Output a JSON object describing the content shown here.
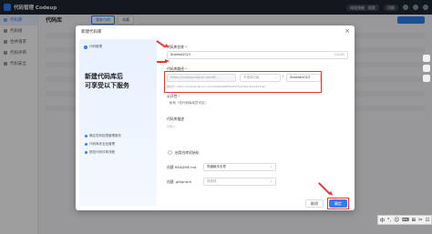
{
  "app": {
    "brand": "代码管理 Codeup"
  },
  "topbar": {
    "search_pill": "研发效能 · 搜索",
    "user_pill": "切换"
  },
  "sidenav": {
    "items": [
      {
        "label": "代码库",
        "active": true
      },
      {
        "label": "代码组",
        "active": false
      },
      {
        "label": "合并请求",
        "active": false
      },
      {
        "label": "代码评审",
        "active": false
      },
      {
        "label": "代码安全",
        "active": false
      }
    ]
  },
  "page": {
    "title": "代码库",
    "tabs": [
      {
        "label": "我参与的",
        "active": true
      },
      {
        "label": "收藏",
        "active": false
      }
    ]
  },
  "dialog": {
    "title": "新建代码库",
    "close_symbol": "×",
    "left_logo": "代码管理",
    "hero": "新建代码库后\n可享受以下服务",
    "features": [
      "确定您有权限管理服务",
      "代码库安全及管理",
      "规范代码评审流程"
    ],
    "form": {
      "name_label": "代码库名称",
      "name_value": "Starlike2023",
      "name_counter": "12/100",
      "path_label": "代码库路径",
      "path_prefix": "https://codeup.aliyun.com/6...",
      "path_group": "不选择分组",
      "path_slash": "/",
      "path_value": "Starlike2023",
      "path_hint": "地址为: https://codeup.aliyun.com/63ebae9f8db4f47ba7/Starlike2023.git",
      "visibility_label": "公开性",
      "visibility_value": "私有（仅代码库成员可见）",
      "desc_label": "代码库描述",
      "desc_placeholder": "请输入",
      "init_label": "启用仓库初始化",
      "readme_label": "创建 README.md",
      "readme_value": "同道新手引导",
      "gitignore_label": "创建 .gitignore",
      "gitignore_value": "请选择"
    },
    "cancel_label": "取消",
    "ok_label": "确定"
  },
  "ime": {
    "items": [
      "中",
      "°,",
      "☺",
      "⌨",
      "⊞",
      "✂",
      "☷"
    ]
  },
  "colors": {
    "accent": "#2f7cf6",
    "annotation": "#e53935",
    "topbar": "#1f2633"
  }
}
